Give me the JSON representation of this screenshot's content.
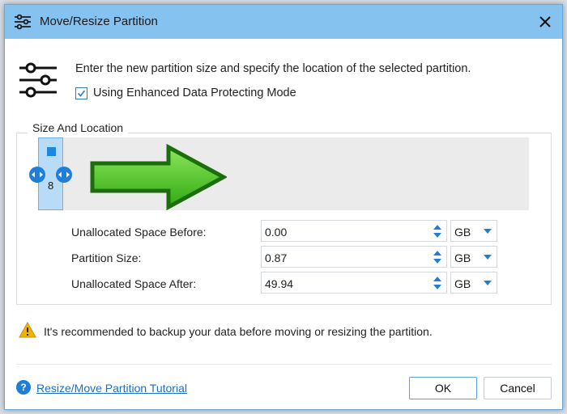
{
  "window": {
    "title": "Move/Resize Partition",
    "icon": "sliders-icon",
    "close_icon": "close-icon"
  },
  "header": {
    "description": "Enter the new partition size and specify the location of the selected partition.",
    "enhanced_mode_label": "Using Enhanced Data Protecting Mode",
    "enhanced_mode_checked": true
  },
  "size_location": {
    "group_title": "Size And Location",
    "partition_label": "8",
    "fields": [
      {
        "label": "Unallocated Space Before:",
        "value": "0.00",
        "unit": "GB"
      },
      {
        "label": "Partition Size:",
        "value": "0.87",
        "unit": "GB"
      },
      {
        "label": "Unallocated Space After:",
        "value": "49.94",
        "unit": "GB"
      }
    ]
  },
  "warning": {
    "text": "It's recommended to backup your data before moving or resizing the partition."
  },
  "footer": {
    "tutorial_link": "Resize/Move Partition Tutorial",
    "ok_label": "OK",
    "cancel_label": "Cancel"
  },
  "colors": {
    "titlebar": "#86c2f0",
    "accent": "#1f7fd8",
    "arrow": "#3dbf1a",
    "partition": "#b8dcf7"
  }
}
